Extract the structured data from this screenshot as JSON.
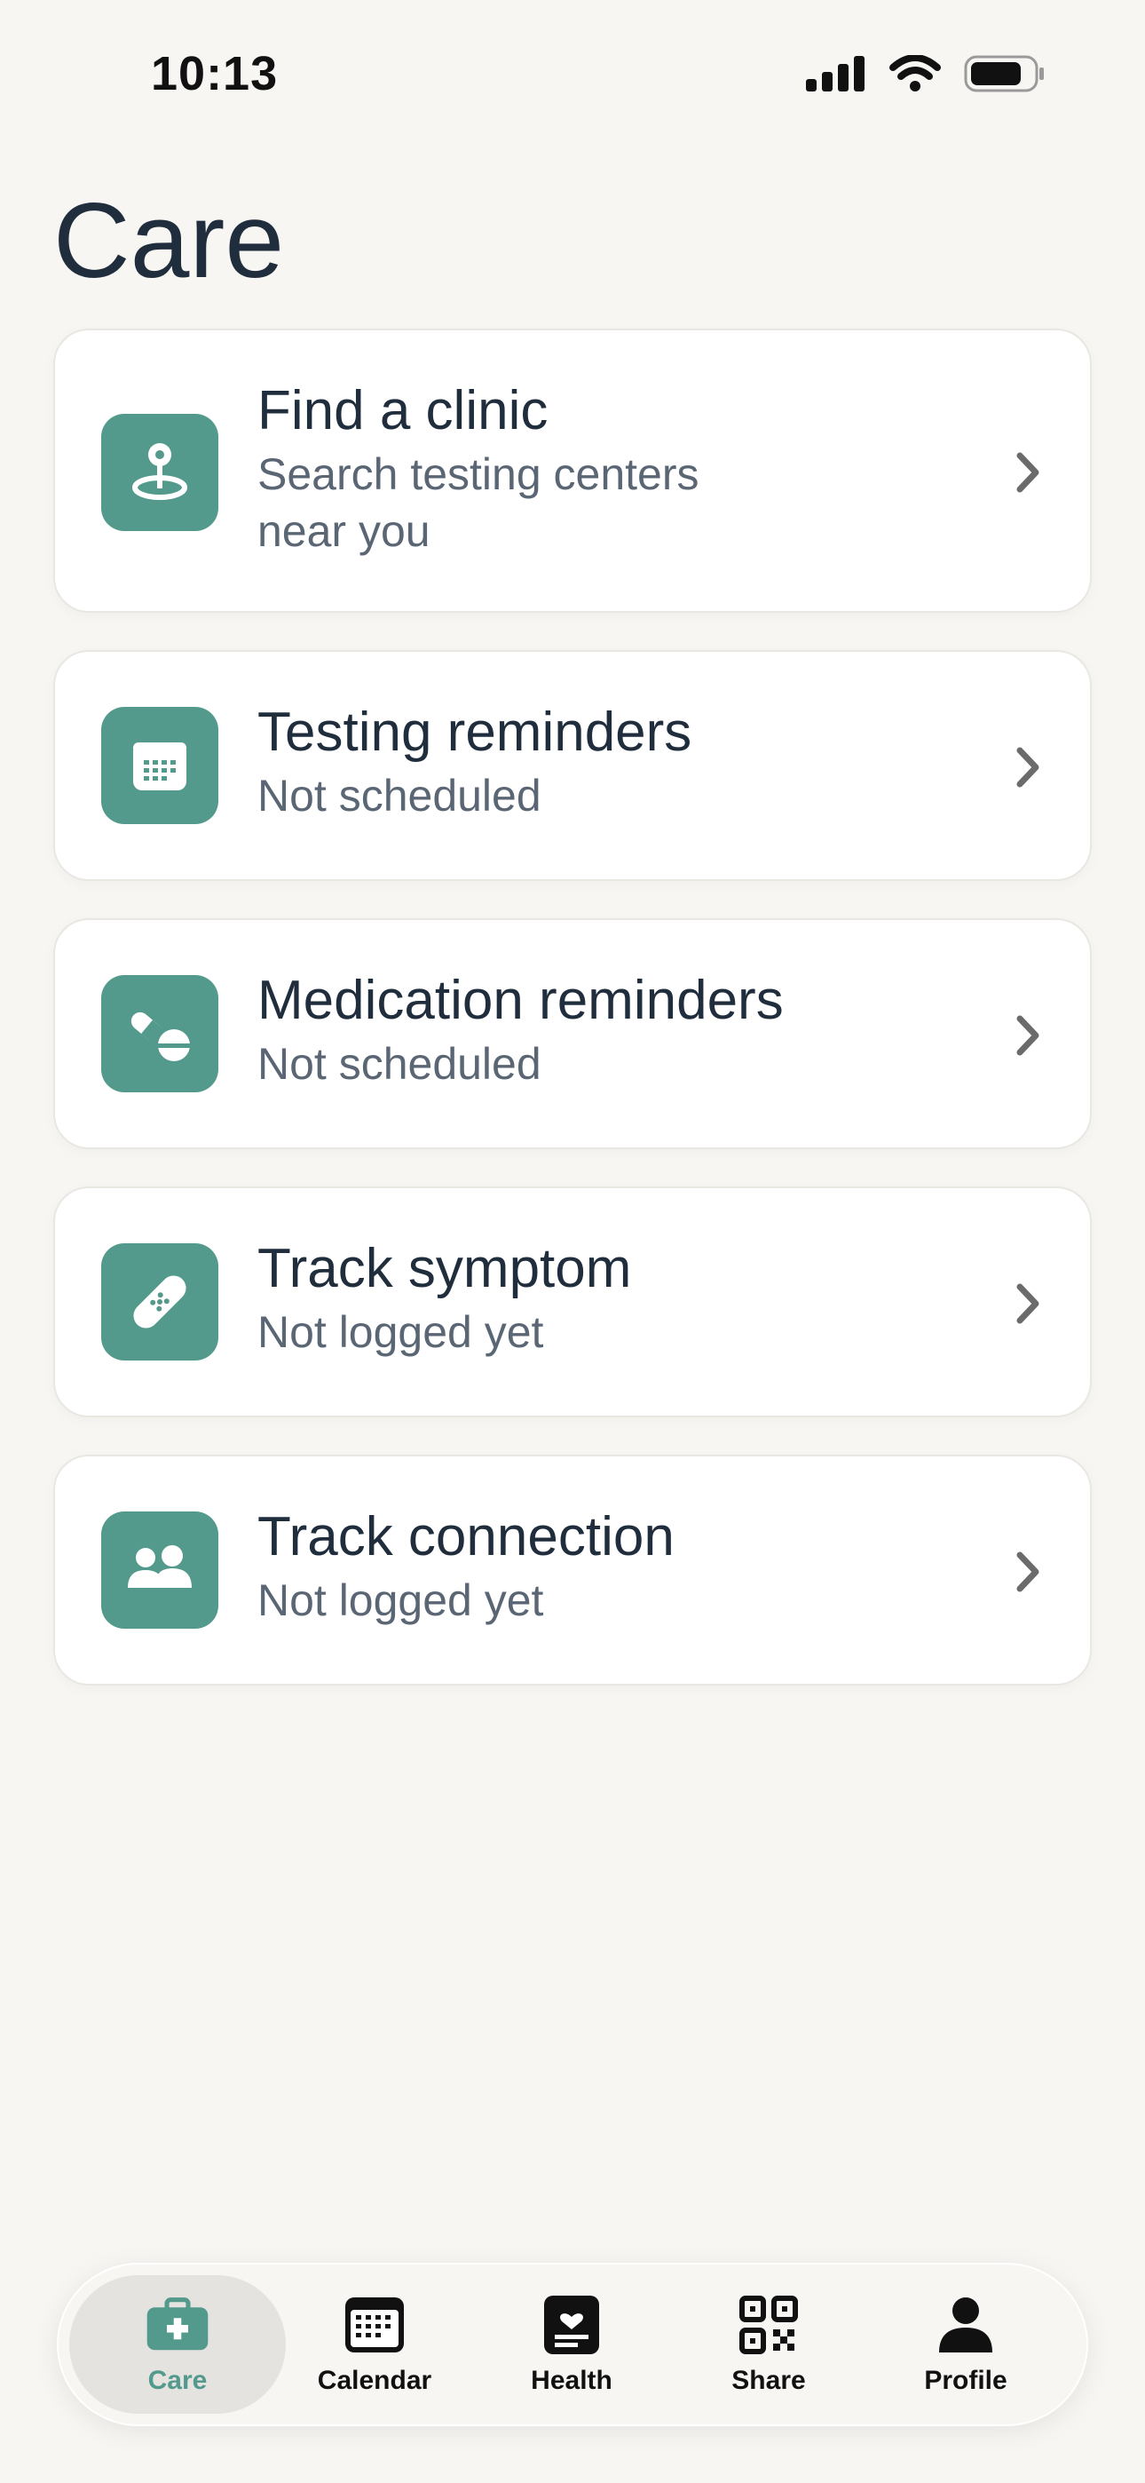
{
  "status_bar": {
    "time": "10:13"
  },
  "page": {
    "title": "Care"
  },
  "colors": {
    "accent": "#539a8c",
    "background": "#f7f6f3",
    "card": "#ffffff",
    "title_text": "#1f2d3d",
    "subtitle_text": "#5b6675"
  },
  "cards": [
    {
      "title": "Find a clinic",
      "subtitle": "Search testing centers near you",
      "icon": "location-pin-icon"
    },
    {
      "title": "Testing reminders",
      "subtitle": "Not scheduled",
      "icon": "calendar-icon"
    },
    {
      "title": "Medication reminders",
      "subtitle": "Not scheduled",
      "icon": "pills-icon"
    },
    {
      "title": "Track symptom",
      "subtitle": "Not logged yet",
      "icon": "bandage-icon"
    },
    {
      "title": "Track connection",
      "subtitle": "Not logged yet",
      "icon": "people-icon"
    }
  ],
  "tabbar": {
    "selected": "Care",
    "tabs": [
      {
        "label": "Care",
        "icon": "medical-kit-icon"
      },
      {
        "label": "Calendar",
        "icon": "calendar-icon"
      },
      {
        "label": "Health",
        "icon": "health-record-icon"
      },
      {
        "label": "Share",
        "icon": "qr-code-icon"
      },
      {
        "label": "Profile",
        "icon": "person-icon"
      }
    ]
  }
}
